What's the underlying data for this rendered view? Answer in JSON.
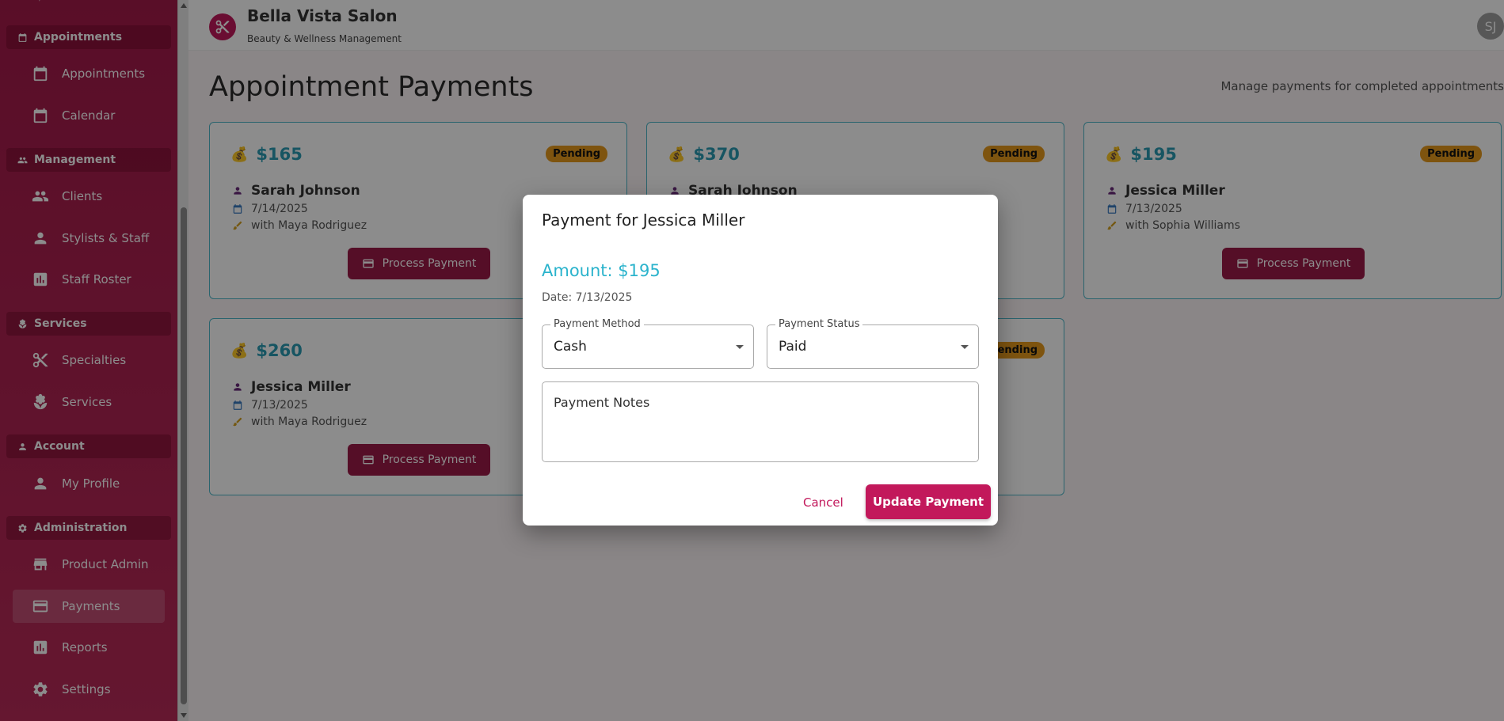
{
  "sidebar": {
    "sections": [
      {
        "label": "Appointments",
        "icon": "calendar-icon"
      },
      {
        "label": "Management",
        "icon": "people-icon"
      },
      {
        "label": "Services",
        "icon": "spa-icon"
      },
      {
        "label": "Account",
        "icon": "person-icon"
      },
      {
        "label": "Administration",
        "icon": "gear-icon"
      }
    ],
    "items": [
      {
        "label": "Appointments",
        "icon": "calendar-icon"
      },
      {
        "label": "Calendar",
        "icon": "calendar-icon"
      },
      {
        "label": "Clients",
        "icon": "people-icon"
      },
      {
        "label": "Stylists & Staff",
        "icon": "person-icon"
      },
      {
        "label": "Staff Roster",
        "icon": "chart-icon"
      },
      {
        "label": "Specialties",
        "icon": "scissors-icon"
      },
      {
        "label": "Services",
        "icon": "spa-icon"
      },
      {
        "label": "My Profile",
        "icon": "person-icon"
      },
      {
        "label": "Product Admin",
        "icon": "store-icon"
      },
      {
        "label": "Payments",
        "icon": "card-icon",
        "active": true
      },
      {
        "label": "Reports",
        "icon": "chart-icon"
      },
      {
        "label": "Settings",
        "icon": "gear-icon"
      }
    ]
  },
  "header": {
    "brand": "Bella Vista Salon",
    "subtitle": "Beauty & Wellness Management",
    "avatar": "SJ"
  },
  "page": {
    "title": "Appointment Payments",
    "subtitle": "Manage payments for completed appointments"
  },
  "cards": [
    {
      "amount": "$165",
      "status": "Pending",
      "client": "Sarah Johnson",
      "date": "7/14/2025",
      "stylist": "with Maya Rodriguez",
      "button": "Process Payment"
    },
    {
      "amount": "$370",
      "status": "Pending",
      "client": "Sarah Johnson",
      "date": "",
      "stylist": "",
      "button": ""
    },
    {
      "amount": "$195",
      "status": "Pending",
      "client": "Jessica Miller",
      "date": "7/13/2025",
      "stylist": "with Sophia Williams",
      "button": "Process Payment"
    },
    {
      "amount": "$260",
      "status": "",
      "client": "Jessica Miller",
      "date": "7/13/2025",
      "stylist": "with Maya Rodriguez",
      "button": "Process Payment"
    },
    {
      "amount": "",
      "status": "Pending",
      "client": "",
      "date": "",
      "stylist": "",
      "button": ""
    }
  ],
  "dialog": {
    "title": "Payment for Jessica Miller",
    "amount": "Amount: $195",
    "date": "Date: 7/13/2025",
    "method_label": "Payment Method",
    "method_value": "Cash",
    "status_label": "Payment Status",
    "status_value": "Paid",
    "notes_placeholder": "Payment Notes",
    "cancel": "Cancel",
    "update": "Update Payment"
  },
  "colors": {
    "sidebar": "#a31a4a",
    "accent": "#c2185b",
    "amount": "#2a9bb3",
    "pending": "#e69a1d"
  }
}
